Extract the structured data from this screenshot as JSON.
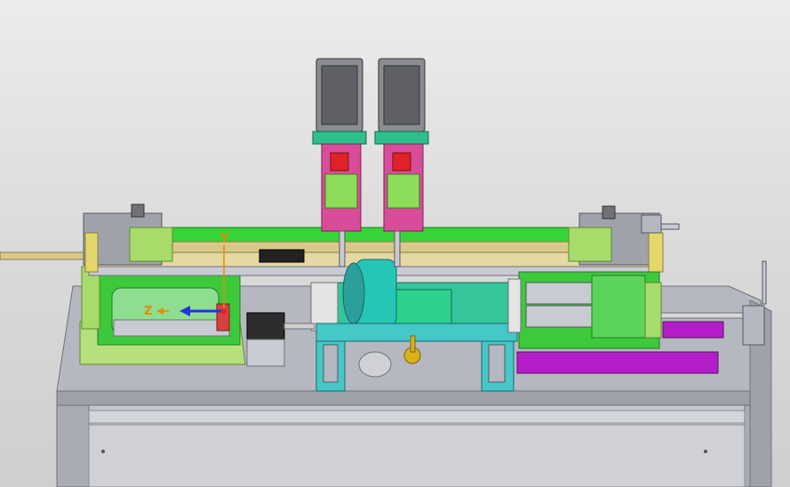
{
  "triad": {
    "y_label": "Y",
    "z_label": "Z"
  },
  "colors": {
    "background": "#e2e2e2",
    "frame_gray": "#b9bcc4",
    "green_light": "#8ddc5a",
    "green": "#44cc44",
    "teal": "#2fd6b0",
    "cyan": "#49c6cc",
    "magenta": "#d4449c",
    "red": "#e0222a",
    "yellow_rail": "#d8c98a",
    "purple": "#b31ec8",
    "gold": "#d8b21a",
    "dark_gray": "#3a3a3a",
    "axis_blue": "#2233dd",
    "axis_orange": "#e68a00"
  }
}
